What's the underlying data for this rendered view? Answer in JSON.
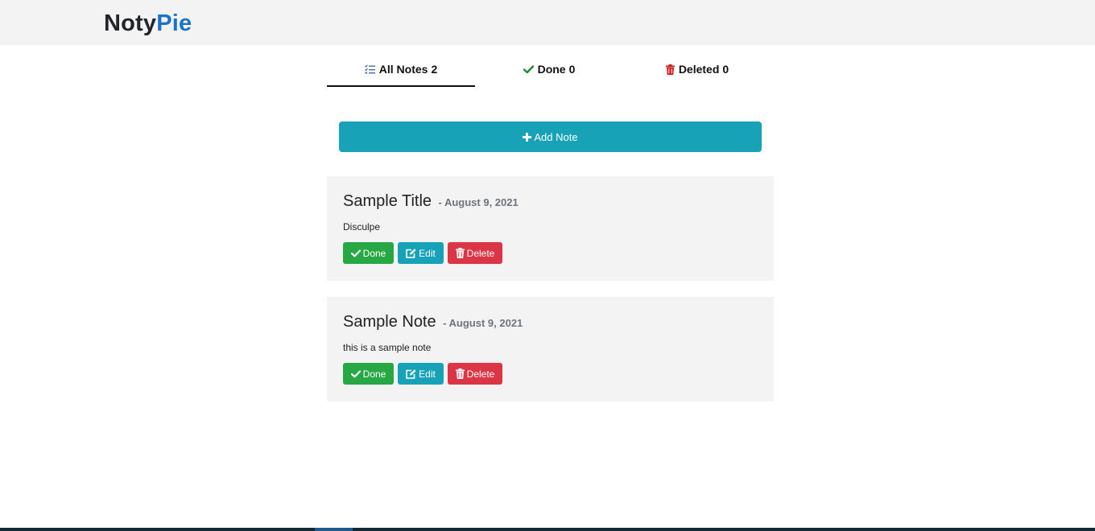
{
  "brand": {
    "part1": "Noty",
    "part2": "Pie"
  },
  "tabs": [
    {
      "label": "All Notes",
      "count": "2",
      "icon": "list-check-icon",
      "active": true
    },
    {
      "label": "Done",
      "count": "0",
      "icon": "check-icon",
      "active": false
    },
    {
      "label": "Deleted",
      "count": "0",
      "icon": "trash-icon",
      "active": false
    }
  ],
  "add_button": {
    "label": "Add Note",
    "icon": "plus-icon"
  },
  "notes": [
    {
      "title": "Sample Title",
      "date": "- August 9, 2021",
      "body": "Disculpe"
    },
    {
      "title": "Sample Note",
      "date": "- August 9, 2021",
      "body": "this is a sample note"
    }
  ],
  "actions": {
    "done": "Done",
    "edit": "Edit",
    "delete": "Delete"
  },
  "colors": {
    "brand_accent": "#1a73c9",
    "info": "#17a2b8",
    "success": "#28a745",
    "danger": "#dc3545",
    "card_bg": "#f3f3f3"
  }
}
